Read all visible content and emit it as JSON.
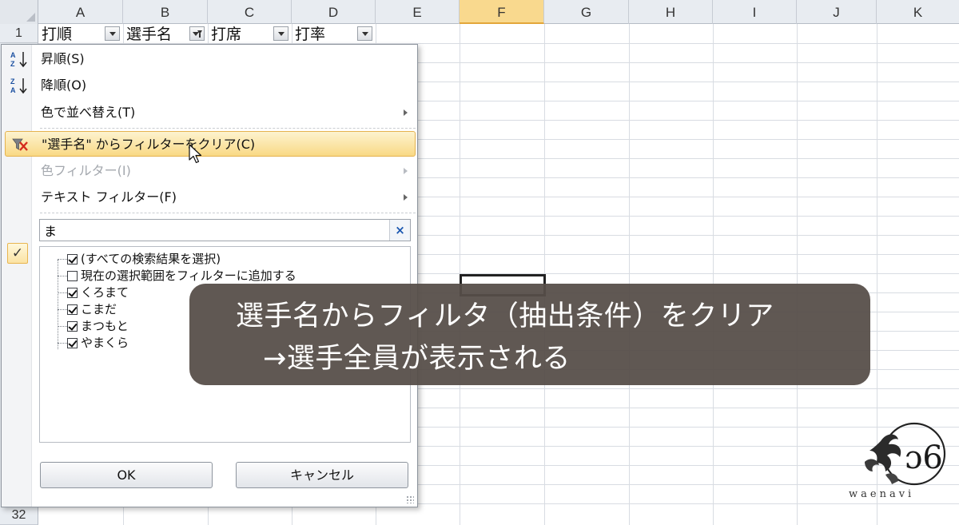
{
  "spreadsheet": {
    "columns": [
      "A",
      "B",
      "C",
      "D",
      "E",
      "F",
      "G",
      "H",
      "I",
      "J",
      "K"
    ],
    "selected_column": "F",
    "rows": {
      "first": "1",
      "last": "32"
    },
    "header_cells": [
      {
        "column": "A",
        "text": "打順",
        "filter_active": false
      },
      {
        "column": "B",
        "text": "選手名",
        "filter_active": true
      },
      {
        "column": "C",
        "text": "打席",
        "filter_active": false
      },
      {
        "column": "D",
        "text": "打率",
        "filter_active": false
      }
    ]
  },
  "filter_menu": {
    "sort_ascending": "昇順(S)",
    "sort_descending": "降順(O)",
    "sort_by_color": "色で並べ替え(T)",
    "clear_filter": "\"選手名\" からフィルターをクリア(C)",
    "color_filter": "色フィルター(I)",
    "text_filter": "テキスト フィルター(F)",
    "search": {
      "value": "ま",
      "clear_symbol": "×"
    },
    "side_check": "✓",
    "items": [
      {
        "label": "(すべての検索結果を選択)",
        "checked": true
      },
      {
        "label": "現在の選択範囲をフィルターに追加する",
        "checked": false
      },
      {
        "label": "くろまて",
        "checked": true
      },
      {
        "label": "こまだ",
        "checked": true
      },
      {
        "label": "まつもと",
        "checked": true
      },
      {
        "label": "やまくら",
        "checked": true
      }
    ],
    "ok_label": "OK",
    "cancel_label": "キャンセル"
  },
  "caption": {
    "line1": "選手名からフィルタ（抽出条件）をクリア",
    "line2": "→選手全員が表示される"
  },
  "logo": {
    "text": "waenavi"
  },
  "colors": {
    "header_bg": "#e8ecf1",
    "selected_column_bg": "#f9d98e",
    "menu_hover": "#f9d985",
    "caption_bg": "#564e48"
  }
}
